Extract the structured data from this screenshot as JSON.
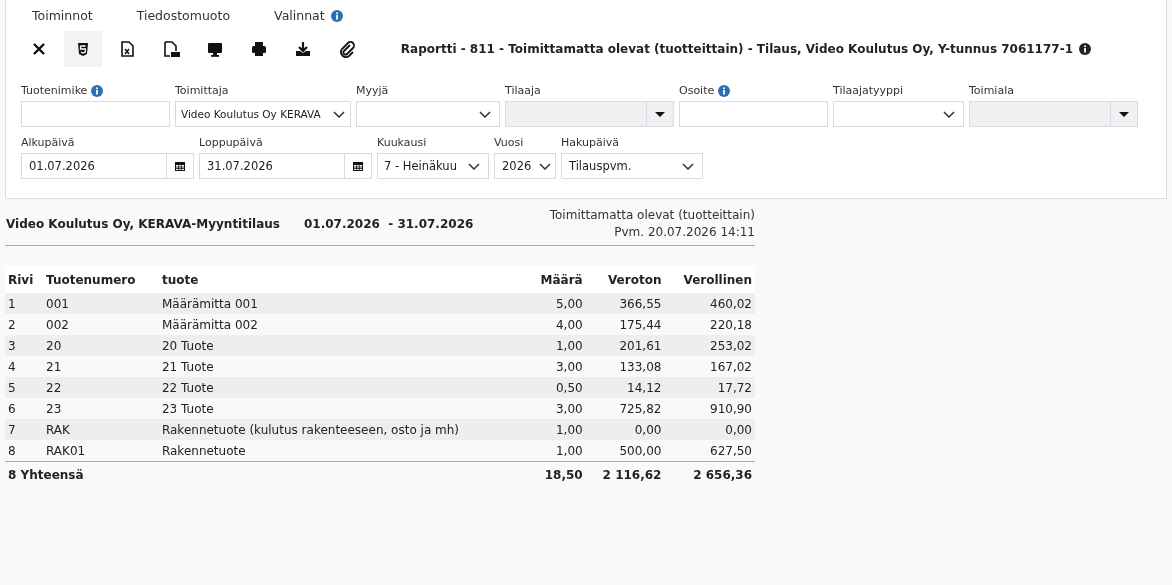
{
  "menu": [
    {
      "label": "Toiminnot",
      "info": false
    },
    {
      "label": "Tiedostomuoto",
      "info": false
    },
    {
      "label": "Valinnat",
      "info": true
    }
  ],
  "toolbar": [
    {
      "kind": "close",
      "selected": false
    },
    {
      "kind": "html",
      "selected": true
    },
    {
      "kind": "excel",
      "selected": false
    },
    {
      "kind": "pdf",
      "selected": false
    },
    {
      "kind": "screen",
      "selected": false
    },
    {
      "kind": "print",
      "selected": false
    },
    {
      "kind": "download",
      "selected": false
    },
    {
      "kind": "attach",
      "selected": false
    }
  ],
  "report_title": "Raportti - 811 - Toimittamatta olevat (tuotteittain) - Tilaus, Video Koulutus Oy, Y-tunnus 7061177-1",
  "filters_row_1": [
    {
      "label": "Tuotenimike",
      "info": true,
      "kind": "text"
    },
    {
      "label": "Toimittaja",
      "info": false,
      "kind": "select",
      "value": "Video Koulutus Oy KERAVA"
    },
    {
      "label": "Myyjä",
      "info": false,
      "kind": "select"
    },
    {
      "label": "Tilaaja",
      "info": false,
      "kind": "combo",
      "disabled": true
    },
    {
      "label": "Osoite",
      "info": true,
      "kind": "text"
    },
    {
      "label": "Tilaajatyyppi",
      "info": false,
      "kind": "select"
    },
    {
      "label": "Toimiala",
      "info": false,
      "kind": "combo",
      "disabled": true
    }
  ],
  "filters_row_2": [
    {
      "label": "Alkupäivä",
      "info": false,
      "kind": "date",
      "value": "01.07.2026"
    },
    {
      "label": "Loppupäivä",
      "info": false,
      "kind": "date",
      "value": "31.07.2026"
    },
    {
      "label": "Kuukausi",
      "info": false,
      "kind": "select",
      "value": "7 - Heinäkuu"
    },
    {
      "label": "Vuosi",
      "info": false,
      "kind": "select",
      "value": "2026"
    },
    {
      "label": "Hakupäivä",
      "info": false,
      "kind": "select",
      "value": "Tilauspvm."
    }
  ],
  "report": {
    "company": "Video Koulutus Oy, KERAVA-Myyntitilaus",
    "period": "01.07.2026  - 31.07.2026",
    "subtitle": "Toimittamatta olevat (tuotteittain)",
    "printed": "Pvm. 20.07.2026 14:11"
  },
  "table": {
    "columns": [
      "Rivi",
      "Tuotenumero",
      "tuote",
      "Määrä",
      "Veroton",
      "Verollinen"
    ],
    "rows": [
      [
        "1",
        "001",
        "Määrämitta 001",
        "5,00",
        "366,55",
        "460,02"
      ],
      [
        "2",
        "002",
        "Määrämitta 002",
        "4,00",
        "175,44",
        "220,18"
      ],
      [
        "3",
        "20",
        "20 Tuote",
        "1,00",
        "201,61",
        "253,02"
      ],
      [
        "4",
        "21",
        "21 Tuote",
        "3,00",
        "133,08",
        "167,02"
      ],
      [
        "5",
        "22",
        "22 Tuote",
        "0,50",
        "14,12",
        "17,72"
      ],
      [
        "6",
        "23",
        "23 Tuote",
        "3,00",
        "725,82",
        "910,90"
      ],
      [
        "7",
        "RAK",
        "Rakennetuote (kulutus rakenteeseen, osto ja mh)",
        "1,00",
        "0,00",
        "0,00"
      ],
      [
        "8",
        "RAK01",
        "Rakennetuote",
        "1,00",
        "500,00",
        "627,50"
      ]
    ],
    "total": {
      "label": "8 Yhteensä",
      "values": [
        "18,50",
        "2 116,62",
        "2 656,36"
      ]
    }
  }
}
